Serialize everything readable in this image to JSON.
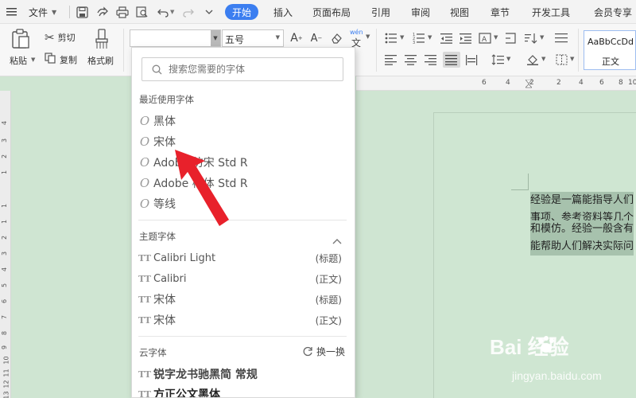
{
  "menubar": {
    "file_label": "文件",
    "tabs": [
      {
        "label": "开始",
        "active": true
      },
      {
        "label": "插入"
      },
      {
        "label": "页面布局"
      },
      {
        "label": "引用"
      },
      {
        "label": "审阅"
      },
      {
        "label": "视图"
      },
      {
        "label": "章节"
      },
      {
        "label": "开发工具"
      },
      {
        "label": "会员专享"
      }
    ],
    "accent_color": "#3b7ef0"
  },
  "clipboard": {
    "paste_label": "粘贴",
    "cut_label": "剪切",
    "copy_label": "复制",
    "format_painter_label": "格式刷"
  },
  "font_controls": {
    "font_name_value": "",
    "font_size_value": "五号",
    "phonetic_label": "wén"
  },
  "styles": {
    "preview_sample": "AaBbCcDd",
    "preview_name": "正文"
  },
  "ruler": {
    "h_ticks": [
      "6",
      "4",
      "2",
      "2",
      "4",
      "6",
      "8",
      "10"
    ],
    "v_ticks": [
      "4",
      "3",
      "2",
      "1",
      "1",
      "1",
      "2",
      "3",
      "4",
      "5",
      "6",
      "7",
      "8",
      "9",
      "10",
      "11",
      "12",
      "13"
    ]
  },
  "font_dropdown": {
    "search_placeholder": "搜索您需要的字体",
    "recent_title": "最近使用字体",
    "recent_fonts": [
      "黑体",
      "宋体",
      "Adobe 仿宋 Std R",
      "Adobe 楷体 Std R",
      "等线"
    ],
    "theme_title": "主题字体",
    "theme_fonts": [
      {
        "name": "Calibri Light",
        "tag": "(标题)"
      },
      {
        "name": "Calibri",
        "tag": "(正文)"
      },
      {
        "name": "宋体",
        "tag": "(标题)"
      },
      {
        "name": "宋体",
        "tag": "(正文)"
      }
    ],
    "cloud_title": "云字体",
    "refresh_label": "换一换",
    "cloud_fonts": [
      "锐字龙书驰黑简 常规",
      "方正公文黑体"
    ]
  },
  "document": {
    "lines": [
      "经验是一篇能指导人们",
      "事项、参考资料等几个",
      "和模仿。经验一般含有",
      "能帮助人们解决实际问"
    ]
  },
  "watermark": {
    "brand": "Bai 经验",
    "url": "jingyan.baidu.com"
  },
  "icons": {
    "arrow_color": "#e8212b"
  }
}
